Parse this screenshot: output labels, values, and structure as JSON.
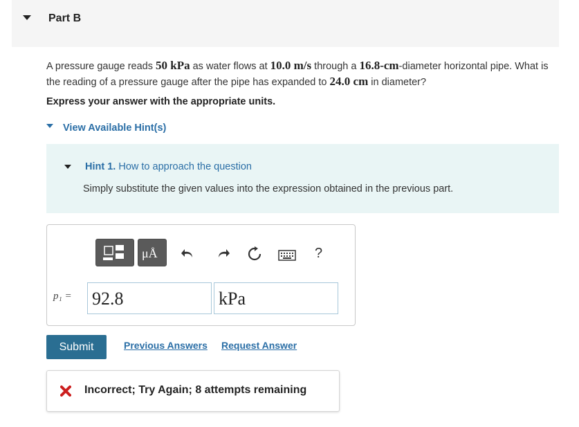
{
  "part": {
    "title": "Part B"
  },
  "question": {
    "t1": "A pressure gauge reads ",
    "m1": "50 kPa",
    "t2": " as water flows at ",
    "m2": "10.0 m/s",
    "t3": " through a ",
    "m3": "16.8-cm",
    "t4": "-diameter horizontal pipe. What is the reading of a pressure gauge after the pipe has expanded to ",
    "m4": "24.0 cm",
    "t5": " in diameter?"
  },
  "instructions": "Express your answer with the appropriate units.",
  "hints": {
    "toggle_label": "View Available Hint(s)",
    "items": [
      {
        "label": "Hint 1.",
        "title": "How to approach the question",
        "text": "Simply substitute the given values into the expression obtained in the previous part."
      }
    ]
  },
  "toolbar": {
    "buttons": [
      "templates",
      "units",
      "undo",
      "redo",
      "reset",
      "keyboard",
      "help"
    ],
    "units_label": "μÅ",
    "help_label": "?"
  },
  "answer": {
    "variable": "p₁ =",
    "value": "92.8",
    "unit": "kPa"
  },
  "actions": {
    "submit_label": "Submit",
    "previous_answers_label": "Previous Answers",
    "request_answer_label": "Request Answer"
  },
  "feedback": {
    "icon": "x-icon",
    "text": "Incorrect; Try Again; 8 attempts remaining",
    "color": "#cc1f1f"
  },
  "colors": {
    "link": "#2a6ea6",
    "submit_bg": "#2a6e92",
    "hint_bg": "#e9f5f5",
    "header_bg": "#f5f5f5"
  }
}
